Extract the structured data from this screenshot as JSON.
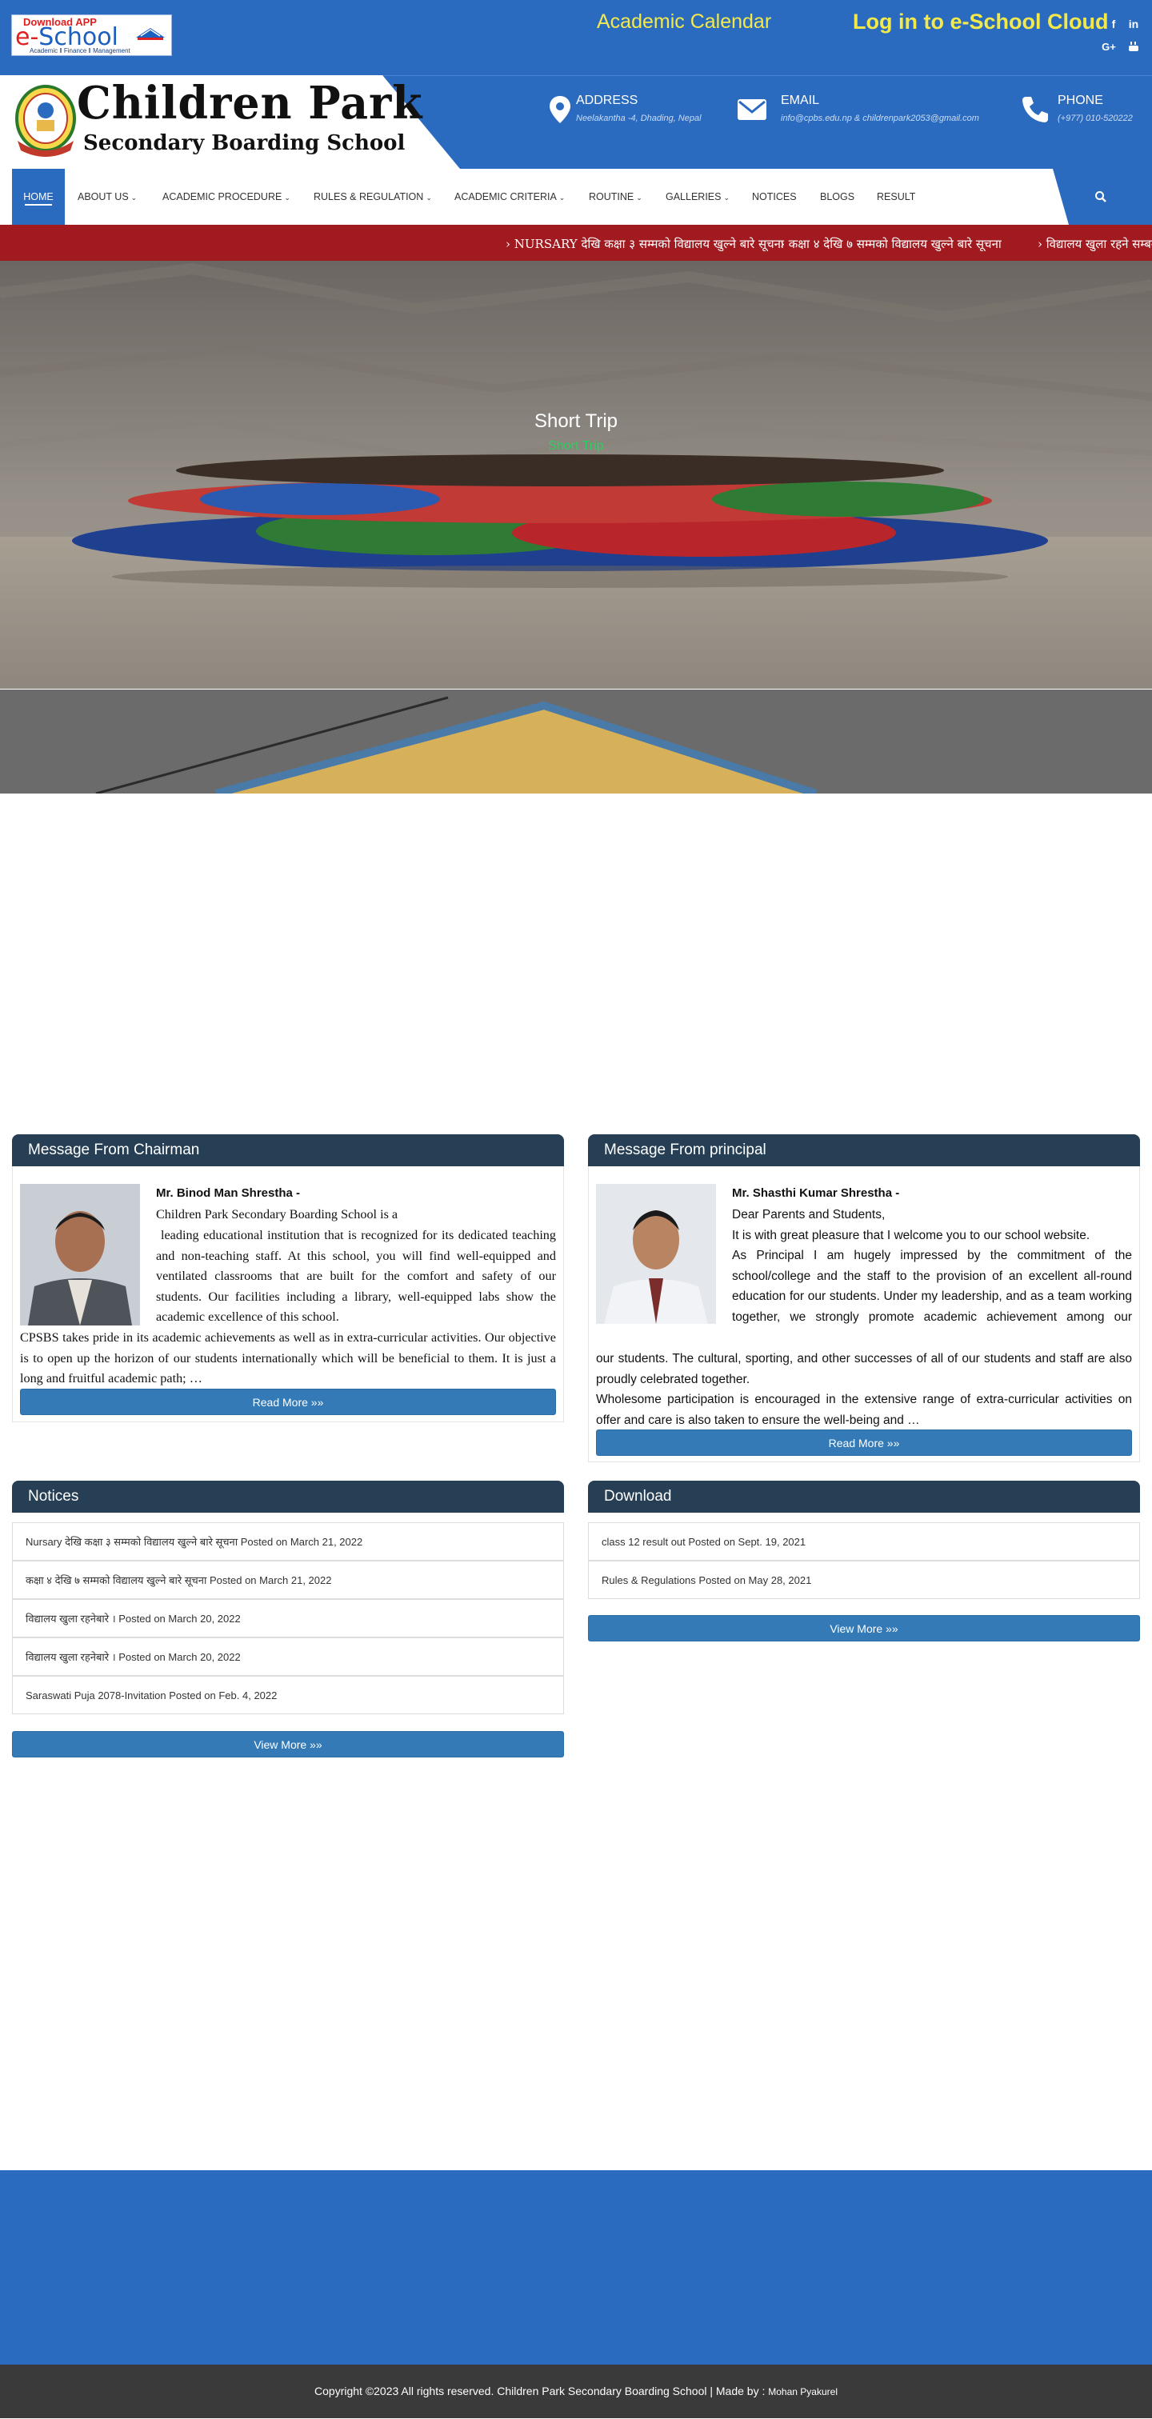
{
  "topbar": {
    "app_badge": {
      "line1": "Download APP",
      "brand_e": "e-",
      "brand_rest": "School",
      "tagline": "Academic ‖ Finance ‖ Management"
    },
    "calendar_link": "Academic Calendar",
    "login_link": "Log in to e-School Cloud",
    "social": [
      "facebook-icon",
      "linkedin-icon",
      "google-plus-icon",
      "youtube-icon"
    ],
    "colors": {
      "bar": "#2b6bbf",
      "link": "#f4e94a"
    }
  },
  "header": {
    "name_line1": "Children Park",
    "name_line2": "Secondary Boarding School",
    "contacts": [
      {
        "title": "ADDRESS",
        "value": "Neelakantha -4, Dhading, Nepal",
        "icon": "map-pin-icon"
      },
      {
        "title": "EMAIL",
        "value": "info@cpbs.edu.np & childrenpark2053@gmail.com",
        "icon": "envelope-icon"
      },
      {
        "title": "PHONE",
        "value": "(+977) 010-520222",
        "icon": "phone-icon"
      }
    ]
  },
  "nav": {
    "items": [
      {
        "label": "HOME",
        "dropdown": false
      },
      {
        "label": "ABOUT US",
        "dropdown": true
      },
      {
        "label": "ACADEMIC PROCEDURE",
        "dropdown": true
      },
      {
        "label": "RULES & REGULATION",
        "dropdown": true
      },
      {
        "label": "ACADEMIC CRITERIA",
        "dropdown": true
      },
      {
        "label": "ROUTINE",
        "dropdown": true
      },
      {
        "label": "GALLERIES",
        "dropdown": true
      },
      {
        "label": "NOTICES",
        "dropdown": false
      },
      {
        "label": "BLOGS",
        "dropdown": false
      },
      {
        "label": "RESULT",
        "dropdown": false
      }
    ],
    "search_icon": "search-icon"
  },
  "ticker": {
    "items": [
      "NURSARY ‌‌‌‌‌‌देखि कक्षा ३ सम्मको विद्यालय खुल्ने बारे सूचना",
      "कक्षा ४ देखि ७ सम्मको विद्यालय खुल्ने बारे सूचना",
      "विद्यालय खुला रहने सम्बन्धमा सूचना"
    ],
    "color": "#a01a1f"
  },
  "hero": {
    "title": "Short Trip",
    "subtitle": "Short Trip"
  },
  "chairman": {
    "heading": "Message From Chairman",
    "name": "Mr. Binod Man Shrestha -",
    "intro": "Children Park Secondary Boarding School is a",
    "body": "leading educational institution that is recognized for its dedicated teaching and non-teaching staff. At this school, you will find well-equipped and ventilated classrooms that are built for the comfort and safety of our students. Our facilities including a library, well-equipped labs show the academic excellence of this school.",
    "body2": "CPSBS takes pride in its academic achievements as well as in extra-curricular activities. Our objective is to open up the horizon of our students internationally which will be beneficial to them. It is just a long and fruitful academic path; …",
    "button": "Read More »»"
  },
  "principal": {
    "heading": "Message From principal",
    "name": "Mr. Shasthi Kumar Shrestha -",
    "greeting": "Dear Parents and Students,",
    "line1": "It is with great pleasure that I welcome you to our school website.",
    "body": "As Principal I am hugely impressed by the commitment of the school/college and the staff to the provision of an excellent all-round education for our students. Under my leadership, and as a team working together, we strongly promote academic achievement among our students. The cultural, sporting, and other successes of all of our students and staff are also proudly celebrated together.",
    "body2": "Wholesome participation is encouraged in the extensive range of extra-curricular activities on offer and care is also taken to ensure the well-being and …",
    "button": "Read More »»"
  },
  "notices": {
    "heading": "Notices",
    "items": [
      "Nursary ‌‌‌‌‌‌देखि कक्षा ३ सम्मको विद्यालय खुल्ने बारे सूचना Posted on March 21, 2022",
      "कक्षा ४ देखि ७ सम्मको विद्यालय खुल्ने बारे सूचना Posted on March 21, 2022",
      "विद्यालय खुला रहनेबारे । Posted on March 20, 2022",
      "विद्यालय खुला रहनेबारे । Posted on March 20, 2022",
      "Saraswati Puja 2078-Invitation Posted on Feb. 4, 2022"
    ],
    "button": "View More »»"
  },
  "download": {
    "heading": "Download",
    "items": [
      "class 12 result out Posted on Sept. 19, 2021",
      "Rules & Regulations Posted on May 28, 2021"
    ],
    "button": "View More »»"
  },
  "footer": {
    "copyright": "Copyright ©2023 All rights reserved. Children Park Secondary Boarding School  | Made by :",
    "author": "Mohan Pyakurel"
  }
}
